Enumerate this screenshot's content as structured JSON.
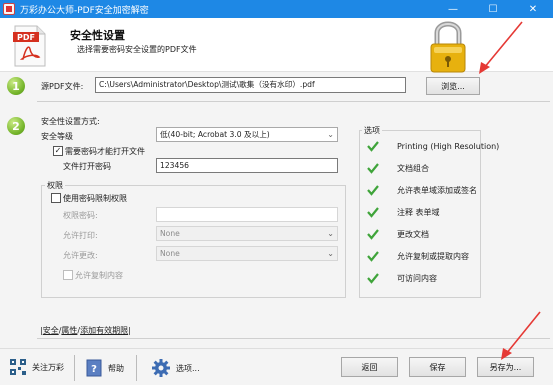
{
  "window": {
    "title": "万彩办公大师-PDF安全加密解密"
  },
  "header": {
    "title": "安全性设置",
    "subtitle": "选择需要密码安全设置的PDF文件",
    "doc_icon_label": "PDF"
  },
  "steps": [
    "1",
    "2"
  ],
  "source": {
    "label": "源PDF文件:",
    "path": "C:\\Users\\Administrator\\Desktop\\测试\\歌集（没有水印）.pdf",
    "browse_label": "浏览..."
  },
  "security": {
    "section_label": "安全性设置方式:",
    "level_label": "安全等级",
    "level_value": "低(40-bit; Acrobat 3.0 及以上)",
    "require_open_password_label": "需要密码才能打开文件",
    "require_open_password_checked": true,
    "open_password_label": "文件打开密码",
    "open_password_value": "123456"
  },
  "permissions": {
    "group_label": "权限",
    "use_perm_password_label": "使用密码限制权限",
    "perm_password_label": "权限密码:",
    "allow_print_label": "允许打印:",
    "allow_print_value": "None",
    "allow_change_label": "允许更改:",
    "allow_change_value": "None",
    "allow_copy_label": "允许复制内容"
  },
  "options": {
    "group_label": "选项",
    "items": [
      "Printing (High Resolution)",
      "文档组合",
      "允许表单域添加或签名",
      "注释 表单域",
      "更改文档",
      "允许复制或提取内容",
      "可访问内容"
    ]
  },
  "tabs": {
    "security": "安全",
    "properties": "属性",
    "add_validity": "添加有效期限"
  },
  "footer": {
    "follow_label": "关注万彩",
    "help_label": "帮助",
    "options_label": "选项...",
    "back_label": "返回",
    "save_label": "保存",
    "save_as_label": "另存为..."
  },
  "colors": {
    "titlebar": "#1e88e5",
    "step_green": "#74b42a",
    "check_green": "#3fa43a",
    "arrow_red": "#e53935"
  }
}
